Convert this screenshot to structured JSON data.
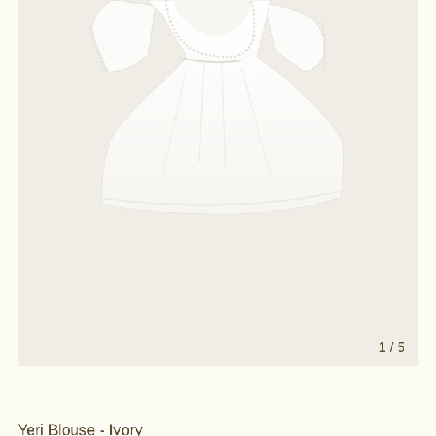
{
  "gallery": {
    "counter": "1 / 5",
    "image_alt": "White puff-sleeve blouse with lace-trimmed scoop neckline"
  },
  "product": {
    "title": "Yeri Blouse - Ivory"
  },
  "colors": {
    "page_background": "#fcfbf4",
    "gallery_background": "#efede5",
    "text": "#5a4a2e",
    "garment": "#ffffff"
  }
}
